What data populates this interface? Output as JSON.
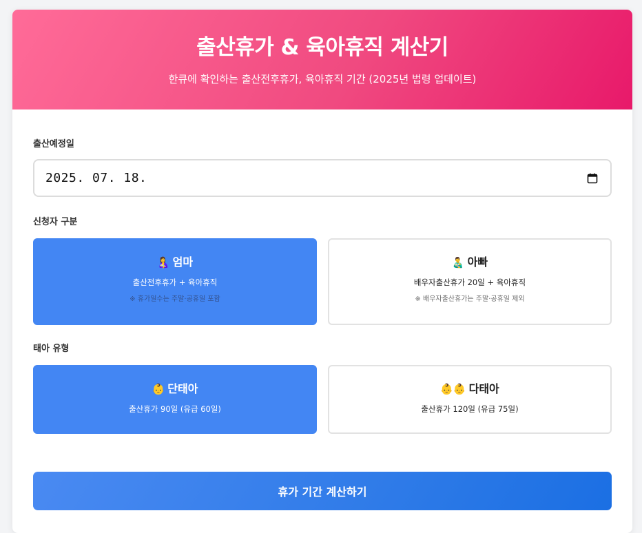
{
  "header": {
    "title": "출산휴가 & 육아휴직 계산기",
    "subtitle": "한큐에 확인하는 출산전후휴가, 육아휴직 기간 (2025년 법령 업데이트)"
  },
  "due_date": {
    "label": "출산예정일",
    "value": "2025. 07. 18."
  },
  "applicant": {
    "label": "신청자 구분",
    "options": [
      {
        "emoji": "🤱",
        "title": "엄마",
        "desc": "출산전후휴가 + 육아휴직",
        "note": "※ 휴가일수는 주말·공휴일 포함",
        "selected": true
      },
      {
        "emoji": "👨‍🍼",
        "title": "아빠",
        "desc": "배우자출산휴가 20일 + 육아휴직",
        "note": "※ 배우자출산휴가는 주말·공휴일 제외",
        "selected": false
      }
    ]
  },
  "baby_type": {
    "label": "태아 유형",
    "options": [
      {
        "emoji": "👶",
        "title": "단태아",
        "desc": "출산휴가 90일 (유급 60일)",
        "selected": true
      },
      {
        "emoji": "👶👶",
        "title": "다태아",
        "desc": "출산휴가 120일 (유급 75일)",
        "selected": false
      }
    ]
  },
  "submit": {
    "label": "휴가 기간 계산하기"
  },
  "colors": {
    "header_gradient_start": "#ff6b98",
    "header_gradient_end": "#e8196a",
    "selected_option": "#4386f3",
    "button_gradient_start": "#4a8af2",
    "button_gradient_end": "#1b6fe3"
  },
  "icons": {
    "date_picker": "calendar-icon"
  }
}
